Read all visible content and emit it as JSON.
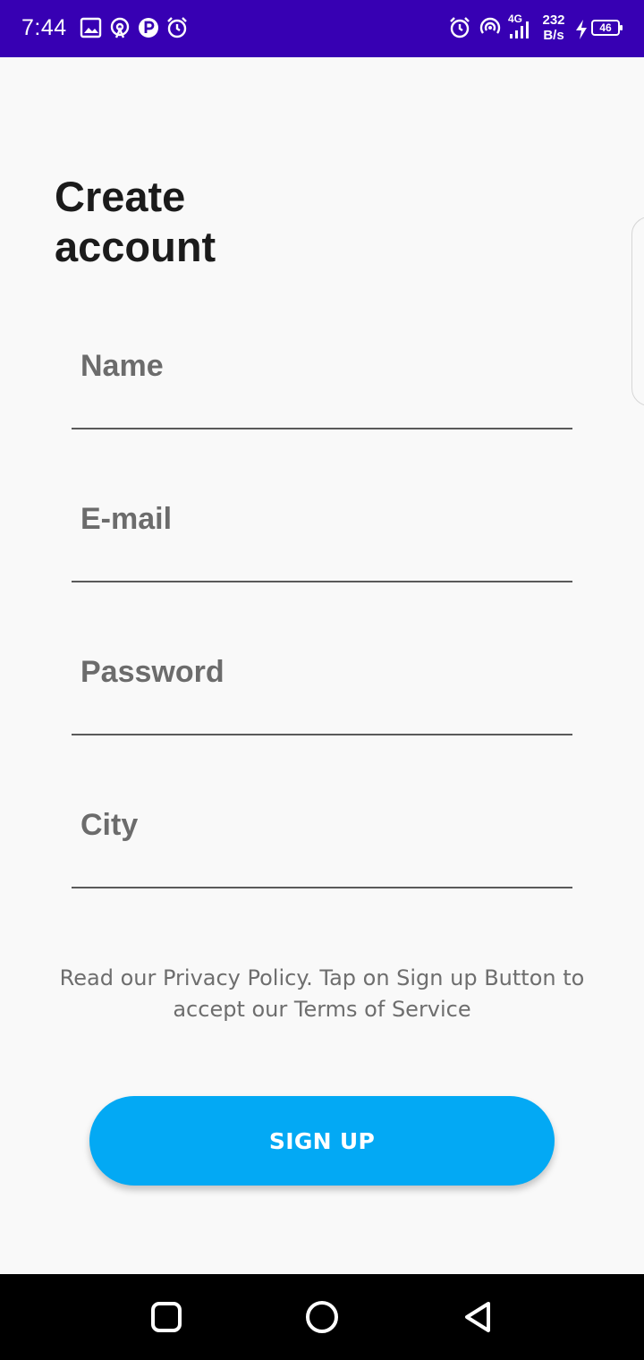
{
  "status_bar": {
    "time": "7:44",
    "left_icons": [
      "image-icon",
      "hotspot-icon",
      "parking-p-icon",
      "alarm-icon"
    ],
    "right_icons": [
      "alarm-icon",
      "hotspot-icon",
      "signal-4g-icon",
      "charging-bolt-icon",
      "battery-icon"
    ],
    "network_label": "4G",
    "speed_value": "232",
    "speed_unit": "B/s",
    "battery_level": "46",
    "background_color": "#3700b3"
  },
  "page": {
    "title": "Create account"
  },
  "form": {
    "fields": [
      {
        "name": "name",
        "placeholder": "Name",
        "type": "text"
      },
      {
        "name": "email",
        "placeholder": "E-mail",
        "type": "email"
      },
      {
        "name": "password",
        "placeholder": "Password",
        "type": "password"
      },
      {
        "name": "city",
        "placeholder": "City",
        "type": "text"
      }
    ]
  },
  "terms_text": "Read our Privacy Policy. Tap on Sign up Button to accept our Terms of Service",
  "signup_button": {
    "label": "SIGN UP",
    "color": "#03a9f4"
  },
  "nav_bar": {
    "icons": [
      "recents-square-icon",
      "home-circle-icon",
      "back-triangle-icon"
    ]
  }
}
